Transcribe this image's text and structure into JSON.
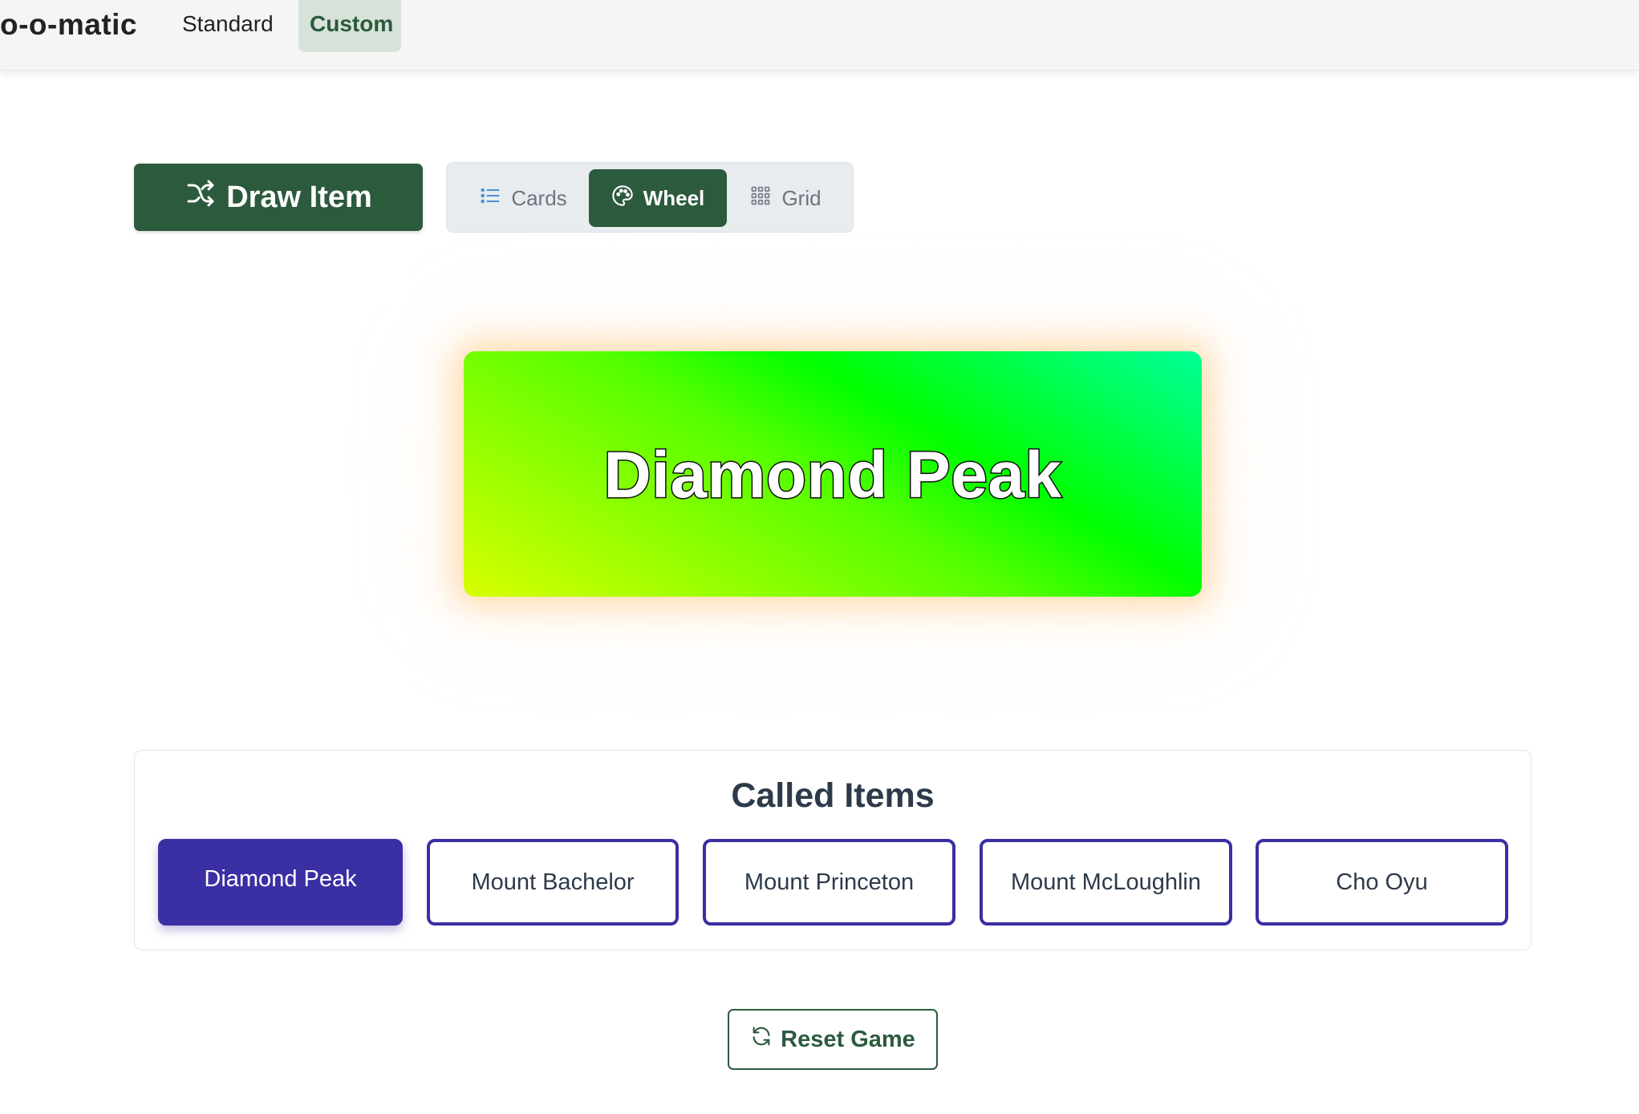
{
  "navbar": {
    "brand": "o-o-matic",
    "links": [
      {
        "label": "Standard"
      },
      {
        "label": "Custom",
        "active": true
      }
    ]
  },
  "controls": {
    "draw_label": "Draw Item",
    "view_options": [
      {
        "label": "Cards",
        "icon": "list-icon"
      },
      {
        "label": "Wheel",
        "icon": "palette-icon",
        "active": true
      },
      {
        "label": "Grid",
        "icon": "grid-icon"
      }
    ]
  },
  "current_item": "Diamond Peak",
  "called": {
    "title": "Called Items",
    "items": [
      {
        "label": "Diamond Peak",
        "active": true
      },
      {
        "label": "Mount Bachelor"
      },
      {
        "label": "Mount Princeton"
      },
      {
        "label": "Mount McLoughlin"
      },
      {
        "label": "Cho Oyu"
      }
    ]
  },
  "reset_label": "Reset Game",
  "colors": {
    "primary_green": "#2c5a3d",
    "called_purple": "#3a2fa3"
  }
}
